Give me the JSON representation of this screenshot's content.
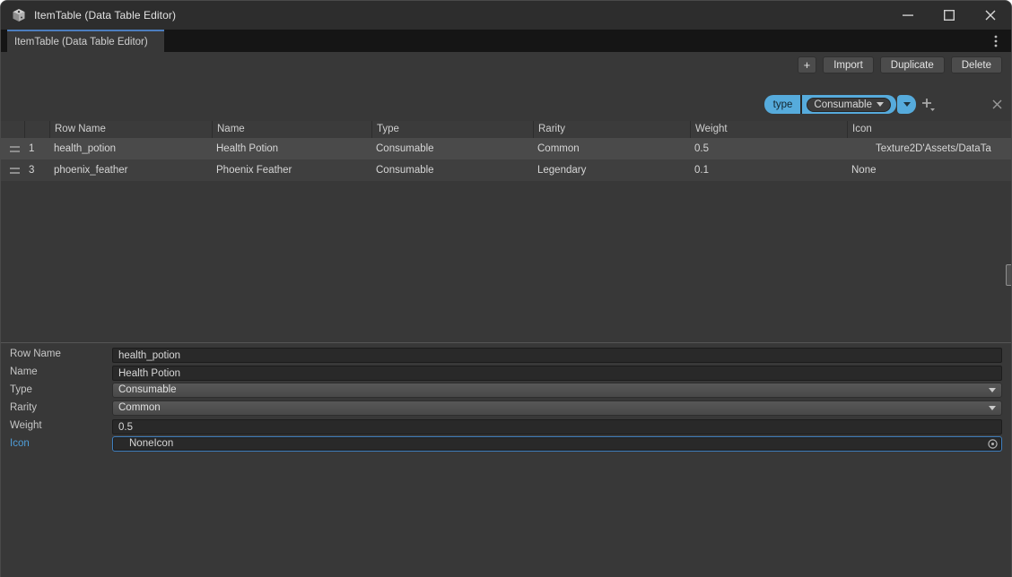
{
  "window": {
    "title": "ItemTable (Data Table Editor)"
  },
  "tab": {
    "label": "ItemTable (Data Table Editor)"
  },
  "toolbar": {
    "add_label": "+",
    "import_label": "Import",
    "duplicate_label": "Duplicate",
    "delete_label": "Delete"
  },
  "filter": {
    "key_label": "type",
    "value_label": "Consumable"
  },
  "table": {
    "columns": [
      "Row Name",
      "Name",
      "Type",
      "Rarity",
      "Weight",
      "Icon"
    ],
    "rows": [
      {
        "index": "1",
        "row_name": "health_potion",
        "name": "Health Potion",
        "type": "Consumable",
        "rarity": "Common",
        "weight": "0.5",
        "icon": "Texture2D'Assets/DataTa",
        "selected": true
      },
      {
        "index": "3",
        "row_name": "phoenix_feather",
        "name": "Phoenix Feather",
        "type": "Consumable",
        "rarity": "Legendary",
        "weight": "0.1",
        "icon": "None",
        "selected": false
      }
    ]
  },
  "details": {
    "fields": [
      {
        "label": "Row Name",
        "value": "health_potion",
        "kind": "text"
      },
      {
        "label": "Name",
        "value": "Health Potion",
        "kind": "text"
      },
      {
        "label": "Type",
        "value": "Consumable",
        "kind": "dropdown"
      },
      {
        "label": "Rarity",
        "value": "Common",
        "kind": "dropdown"
      },
      {
        "label": "Weight",
        "value": "0.5",
        "kind": "text"
      },
      {
        "label": "Icon",
        "value": "NoneIcon",
        "kind": "object"
      }
    ]
  },
  "colors": {
    "accent_tab_blue": "#4c7dbf",
    "filter_chip_blue": "#56abdc",
    "selected_row_bg": "#4a4a4a",
    "focus_border_blue": "#3f7fbf",
    "icon_label_blue": "#4f9ed9",
    "window_bg": "#383838",
    "titlebar_bg": "#2d2d2d"
  }
}
